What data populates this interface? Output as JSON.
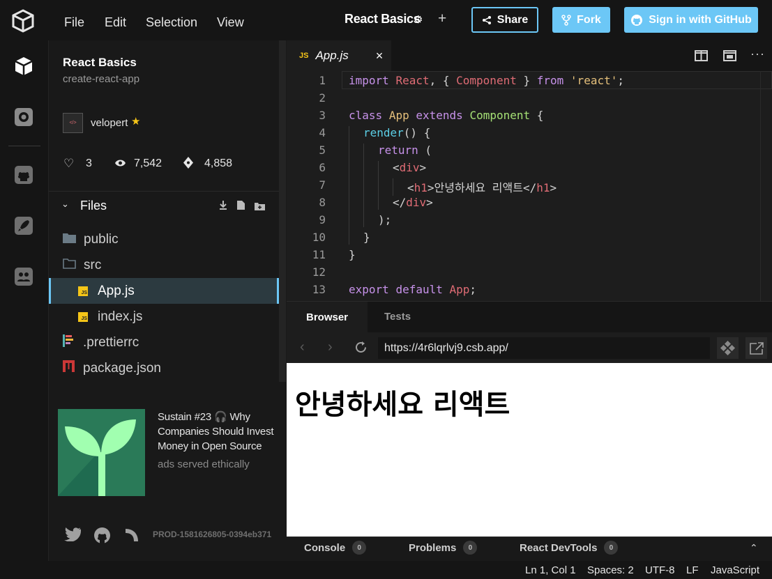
{
  "menu": {
    "file": "File",
    "edit": "Edit",
    "selection": "Selection",
    "view": "View"
  },
  "header": {
    "title": "React Basics",
    "share": "Share",
    "fork": "Fork",
    "github": "Sign in with GitHub"
  },
  "sidebar": {
    "title": "React Basics",
    "template": "create-react-app",
    "author": "velopert",
    "likes": "3",
    "views": "7,542",
    "forks": "4,858",
    "files_header": "Files",
    "files": [
      {
        "name": "public"
      },
      {
        "name": "src"
      },
      {
        "name": "App.js"
      },
      {
        "name": "index.js"
      },
      {
        "name": ".prettierrc"
      },
      {
        "name": "package.json"
      }
    ],
    "js_badge": "JS",
    "ad": {
      "title": "Sustain #23 🎧 Why Companies Should Invest Money in Open Source",
      "sub": "ads served ethically"
    },
    "build": "PROD-1581626805-0394eb371"
  },
  "editor": {
    "tab_badge": "JS",
    "tab_label": "App.js",
    "line_numbers": [
      "1",
      "2",
      "3",
      "4",
      "5",
      "6",
      "7",
      "8",
      "9",
      "10",
      "11",
      "12",
      "13"
    ]
  },
  "preview": {
    "tab_browser": "Browser",
    "tab_tests": "Tests",
    "url": "https://4r6lqrlvj9.csb.app/",
    "heading": "안녕하세요 리액트"
  },
  "devtools": {
    "console": "Console",
    "console_count": "0",
    "problems": "Problems",
    "problems_count": "0",
    "react": "React DevTools",
    "react_count": "0"
  },
  "status": {
    "position": "Ln 1, Col 1",
    "spaces": "Spaces: 2",
    "encoding": "UTF-8",
    "eol": "LF",
    "language": "JavaScript"
  },
  "colors": {
    "accent": "#6cc7f6",
    "star": "#f5c518"
  }
}
